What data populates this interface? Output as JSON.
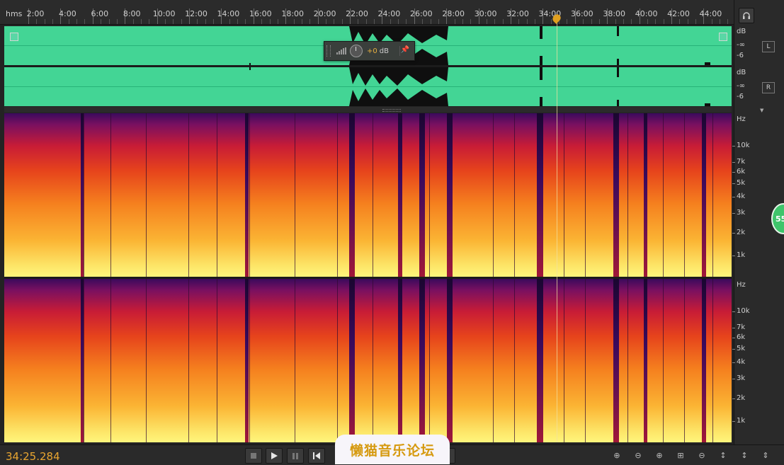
{
  "ruler": {
    "unit_label": "hms",
    "labels": [
      "2:00",
      "4:00",
      "6:00",
      "8:00",
      "10:00",
      "12:00",
      "14:00",
      "16:00",
      "18:00",
      "20:00",
      "22:00",
      "24:00",
      "26:00",
      "28:00",
      "30:00",
      "32:00",
      "34:00",
      "36:00",
      "38:00",
      "40:00",
      "42:00",
      "44:00"
    ]
  },
  "waveform": {
    "left_channel": {
      "db_label": "dB",
      "inf_label": "-∞",
      "minus6_label": "-6",
      "channel_button": "L"
    },
    "right_channel": {
      "db_label": "dB",
      "inf_label": "-∞",
      "minus6_label": "-6",
      "channel_button": "R"
    },
    "color": "#43d595"
  },
  "hud": {
    "gain_value": "+0",
    "gain_unit": "dB"
  },
  "spectrogram": {
    "hz_label": "Hz",
    "ticks": [
      "10k",
      "7k",
      "6k",
      "5k",
      "4k",
      "3k",
      "2k",
      "1k"
    ]
  },
  "transport": {
    "current_time": "34:25.284"
  },
  "watermark": {
    "text": "懒猫音乐论坛"
  },
  "side_badge": {
    "text": "55"
  },
  "colors": {
    "time_accent": "#e8a530",
    "playhead": "#e0a020",
    "waveform": "#43d595"
  }
}
